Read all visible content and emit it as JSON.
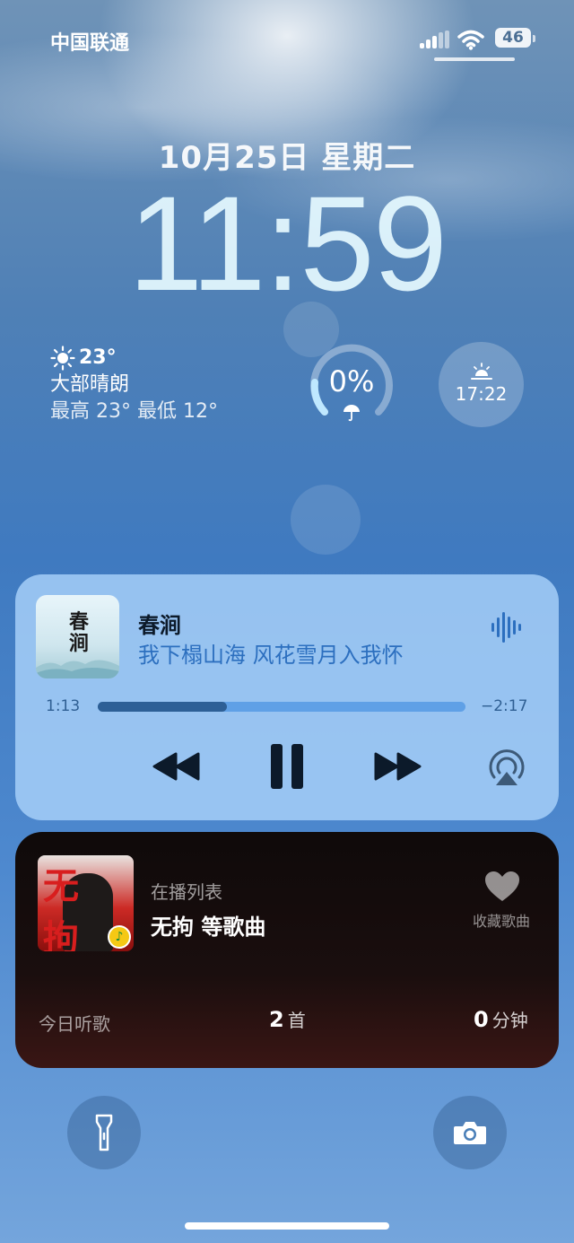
{
  "status_bar": {
    "carrier": "中国联通",
    "battery": "46",
    "icons": [
      "signal-icon",
      "wifi-icon",
      "battery-icon"
    ]
  },
  "lock_screen": {
    "date": "10月25日 星期二",
    "time": "11:59"
  },
  "widgets": {
    "weather": {
      "temp": "23°",
      "condition": "大部晴朗",
      "range": "最高 23° 最低 12°",
      "icon": "sun-icon"
    },
    "rain": {
      "value": "0%",
      "icon": "umbrella-icon"
    },
    "sunset": {
      "time": "17:22",
      "icon": "sunset-icon"
    }
  },
  "now_playing": {
    "album_art_title": "春涧",
    "title": "春涧",
    "subtitle": "我下榻山海 风花雪月入我怀",
    "elapsed": "1:13",
    "remaining": "−2:17",
    "progress": 0.35,
    "controls": [
      "rewind-icon",
      "pause-icon",
      "fast-forward-icon",
      "airplay-icon"
    ],
    "accent": "#2c6fbf"
  },
  "playlist_widget": {
    "album_art_title": "无拘",
    "label": "在播列表",
    "title": "无拘 等歌曲",
    "favorite_label": "收藏歌曲",
    "stats": {
      "label": "今日听歌",
      "songs_value": "2",
      "songs_unit": "首",
      "minutes_value": "0",
      "minutes_unit": "分钟"
    }
  },
  "quick_actions": [
    "flashlight-icon",
    "camera-icon"
  ]
}
